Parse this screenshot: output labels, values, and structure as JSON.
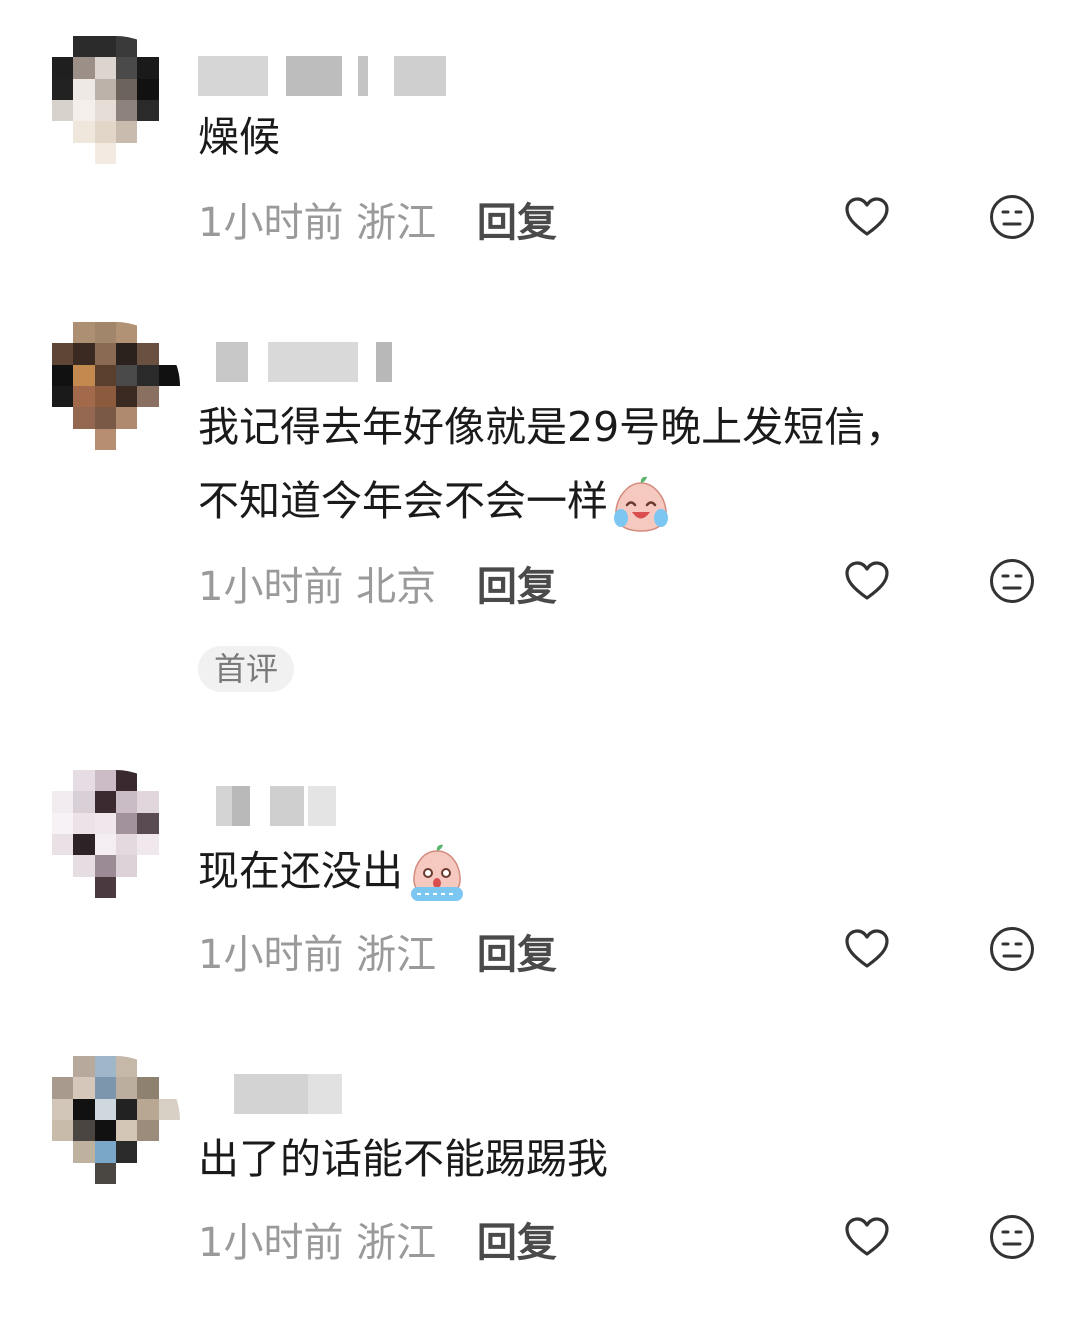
{
  "comments": [
    {
      "text": "燥候",
      "time": "1小时前",
      "location": "浙江",
      "reply_label": "回复"
    },
    {
      "text_line1": "我记得去年好像就是29号晚上发短信，",
      "text_line2": "不知道今年会不会一样",
      "emoji": "laughing-crying-emoji",
      "time": "1小时前",
      "location": "北京",
      "reply_label": "回复",
      "badge": "首评"
    },
    {
      "text": "现在还没出",
      "emoji": "crying-emoji",
      "time": "1小时前",
      "location": "浙江",
      "reply_label": "回复"
    },
    {
      "text": "出了的话能不能踢踢我",
      "time": "1小时前",
      "location": "浙江",
      "reply_label": "回复"
    }
  ],
  "icons": {
    "like": "heart-outline-icon",
    "dislike": "neutral-face-icon"
  },
  "colors": {
    "text": "#1a1a1a",
    "meta": "#9a9a9a",
    "reply": "#4a4a4a",
    "badge_bg": "#f1f1f1"
  }
}
